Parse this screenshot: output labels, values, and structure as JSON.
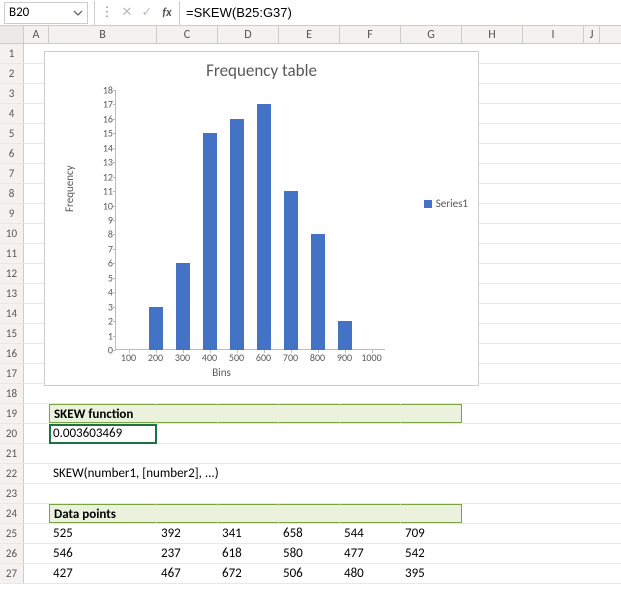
{
  "namebox": {
    "cell_ref": "B20"
  },
  "formula_bar": {
    "formula": "=SKEW(B25:G37)"
  },
  "columns": [
    "A",
    "B",
    "C",
    "D",
    "E",
    "F",
    "G",
    "H",
    "I",
    "J"
  ],
  "rows": 27,
  "cells": {
    "B19": "SKEW function",
    "B20": "0.003603469",
    "B22": "SKEW(number1, [number2], ...)",
    "B24": "Data points"
  },
  "data_table": {
    "start_row": 25,
    "rows": [
      [
        "525",
        "392",
        "341",
        "658",
        "544",
        "709"
      ],
      [
        "546",
        "237",
        "618",
        "580",
        "477",
        "542"
      ],
      [
        "427",
        "467",
        "672",
        "506",
        "480",
        "395"
      ]
    ]
  },
  "chart_data": {
    "type": "bar",
    "title": "Frequency table",
    "xlabel": "Bins",
    "ylabel": "Frequency",
    "legend": [
      "Series1"
    ],
    "categories": [
      "100",
      "200",
      "300",
      "400",
      "500",
      "600",
      "700",
      "800",
      "900",
      "1000"
    ],
    "series": [
      {
        "name": "Series1",
        "values": [
          0,
          3,
          6,
          15,
          16,
          17,
          11,
          8,
          2,
          0
        ]
      }
    ],
    "ylim": [
      0,
      18
    ],
    "ytick_step": 1
  }
}
